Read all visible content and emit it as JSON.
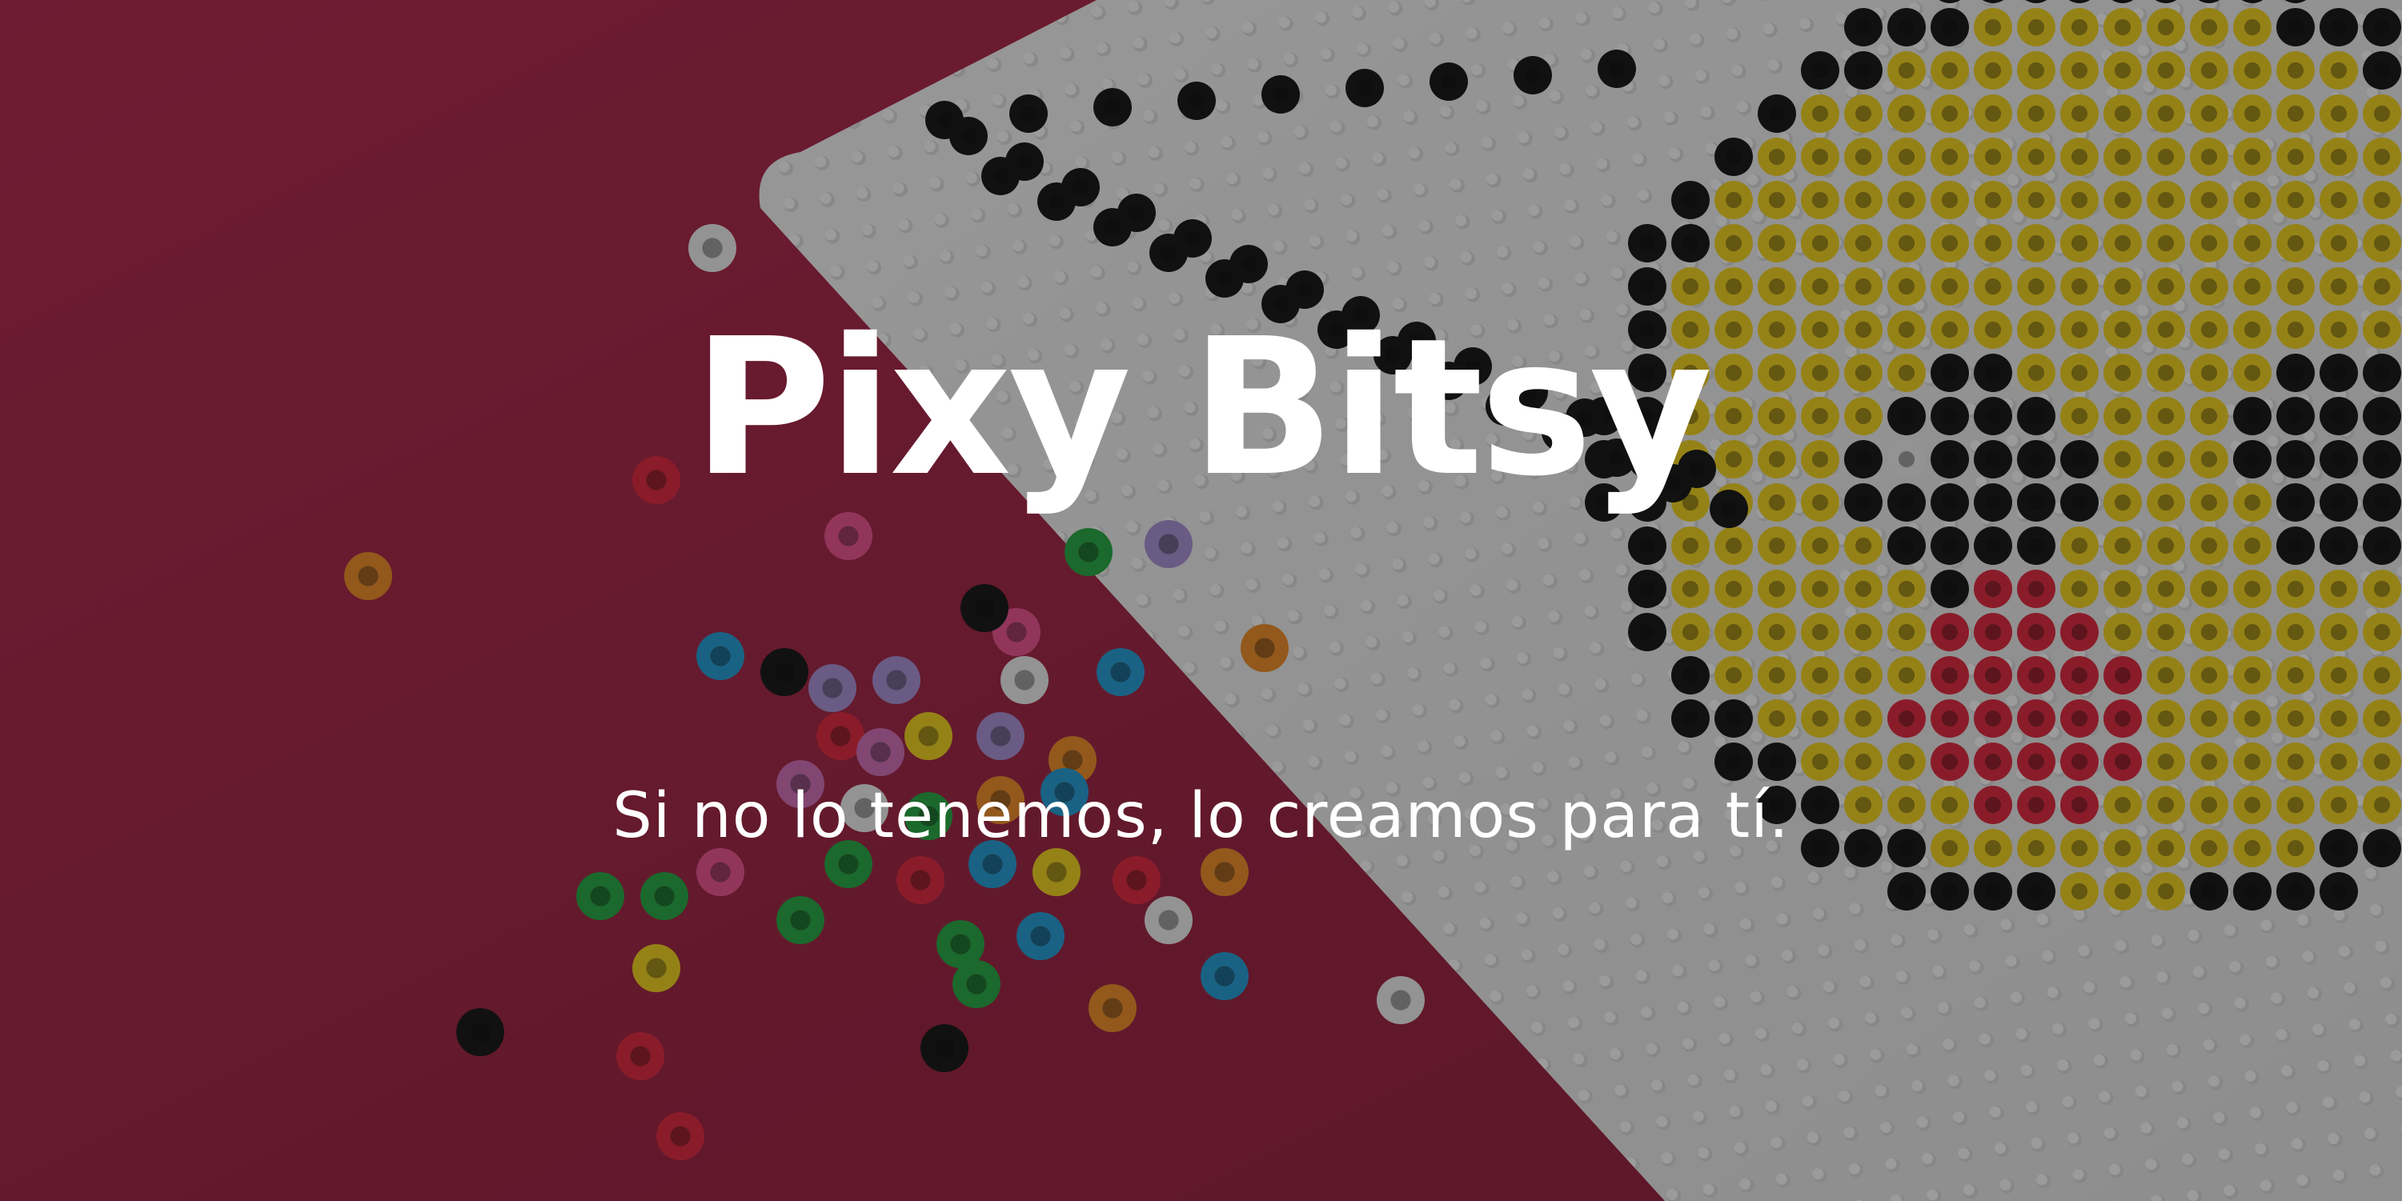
{
  "hero": {
    "title": "Pixy Bitsy",
    "subtitle": "Si no lo tenemos, lo creamos para tí."
  },
  "background": {
    "description_icon": "perler-beads-photo",
    "table_color": "#a0203f",
    "pegboard_color": "#f2f2f2",
    "bead_colors": [
      "#111111",
      "#f3d21a",
      "#e0243a",
      "#f0f0f0",
      "#1f9bd6",
      "#22a83f",
      "#f08a23",
      "#d06bb5",
      "#a88fd6",
      "#ee4f8f"
    ]
  }
}
